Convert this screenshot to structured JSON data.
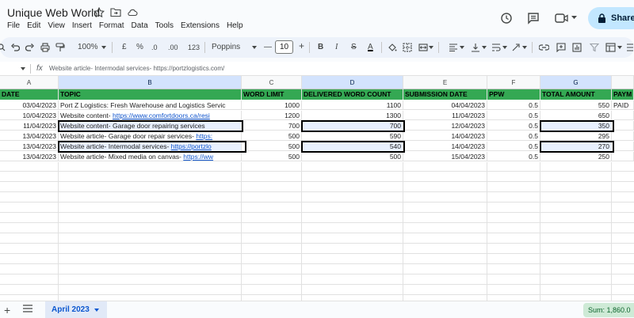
{
  "app": {
    "title": "Unique Web World",
    "share_label": "Share"
  },
  "menu": [
    "File",
    "Edit",
    "View",
    "Insert",
    "Format",
    "Data",
    "Tools",
    "Extensions",
    "Help"
  ],
  "toolbar": {
    "zoom": "100%",
    "currency": "£",
    "percent": "%",
    "dec_decrease": ".0",
    "dec_increase": ".00",
    "number_format": "123",
    "font": "Poppins",
    "font_size": "10",
    "minus": "—",
    "plus": "+",
    "bold": "B",
    "italic": "I",
    "strike": "S",
    "text_color": "A"
  },
  "formula": {
    "cell_ref": "",
    "fx": "fx",
    "text": "Website article- Intermodal services- https://portzlogistics.com/"
  },
  "columns": [
    "A",
    "B",
    "C",
    "D",
    "E",
    "F",
    "G",
    ""
  ],
  "header_row": [
    "DATE",
    "TOPIC",
    "WORD LIMIT",
    "DELIVERED WORD COUNT",
    "SUBMISSION DATE",
    "PPW",
    "TOTAL AMOUNT",
    "PAYM"
  ],
  "rows": [
    {
      "date": "03/04/2023",
      "topic": "Port Z Logistics: Fresh Warehouse and Logistics Servic",
      "link": "",
      "limit": "1000",
      "delivered": "1100",
      "submission": "04/04/2023",
      "ppw": "0.5",
      "total": "550",
      "pay": "PAID"
    },
    {
      "date": "10/04/2023",
      "topic": "Website content- ",
      "link": "https://www.comfortdoors.ca/resi",
      "limit": "1200",
      "delivered": "1300",
      "submission": "11/04/2023",
      "ppw": "0.5",
      "total": "650",
      "pay": ""
    },
    {
      "date": "11/04/2023",
      "topic": "Website content- Garage door repairing services",
      "link": "",
      "limit": "700",
      "delivered": "700",
      "submission": "12/04/2023",
      "ppw": "0.5",
      "total": "350",
      "pay": ""
    },
    {
      "date": "13/04/2023",
      "topic": "Website article- Garage door repair services- ",
      "link": "https:",
      "limit": "500",
      "delivered": "590",
      "submission": "14/04/2023",
      "ppw": "0.5",
      "total": "295",
      "pay": ""
    },
    {
      "date": "13/04/2023",
      "topic": "Website article- Intermodal services- ",
      "link": "https://portzlo",
      "limit": "500",
      "delivered": "540",
      "submission": "14/04/2023",
      "ppw": "0.5",
      "total": "270",
      "pay": ""
    },
    {
      "date": "13/04/2023",
      "topic": "Website article- Mixed media on canvas- ",
      "link": "https://ww",
      "limit": "500",
      "delivered": "500",
      "submission": "15/04/2023",
      "ppw": "0.5",
      "total": "250",
      "pay": ""
    }
  ],
  "sheet": {
    "tab_label": "April 2023",
    "sum_label": "Sum: 1,860.0"
  },
  "colors": {
    "header_green": "#34a853",
    "selection_blue": "#e8f0fe",
    "share_bg": "#c2e7ff"
  }
}
